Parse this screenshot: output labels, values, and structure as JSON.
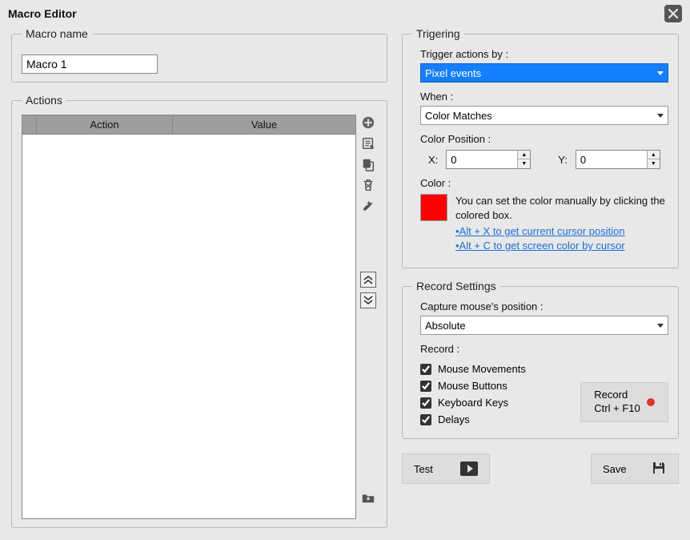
{
  "window": {
    "title": "Macro Editor"
  },
  "macro_name": {
    "legend": "Macro name",
    "value": "Macro 1"
  },
  "actions": {
    "legend": "Actions",
    "col_action": "Action",
    "col_value": "Value"
  },
  "triggering": {
    "legend": "Trigering",
    "trigger_by_label": "Trigger actions by :",
    "trigger_by_value": "Pixel events",
    "when_label": "When :",
    "when_value": "Color Matches",
    "color_pos_label": "Color Position :",
    "x_label": "X:",
    "x_value": "0",
    "y_label": "Y:",
    "y_value": "0",
    "color_label": "Color :",
    "color_hex": "#ff0000",
    "color_hint": "You can set the color manually by clicking the colored box.",
    "link_altx": "•Alt + X to get current cursor position",
    "link_altc": "•Alt + C to get screen color by cursor"
  },
  "record_settings": {
    "legend": "Record Settings",
    "capture_label": "Capture mouse's position :",
    "capture_value": "Absolute",
    "record_label": "Record :",
    "chk_movements": "Mouse Movements",
    "chk_buttons": "Mouse Buttons",
    "chk_keys": "Keyboard Keys",
    "chk_delays": "Delays",
    "record_btn_line1": "Record",
    "record_btn_line2": "Ctrl + F10"
  },
  "buttons": {
    "test": "Test",
    "save": "Save"
  }
}
